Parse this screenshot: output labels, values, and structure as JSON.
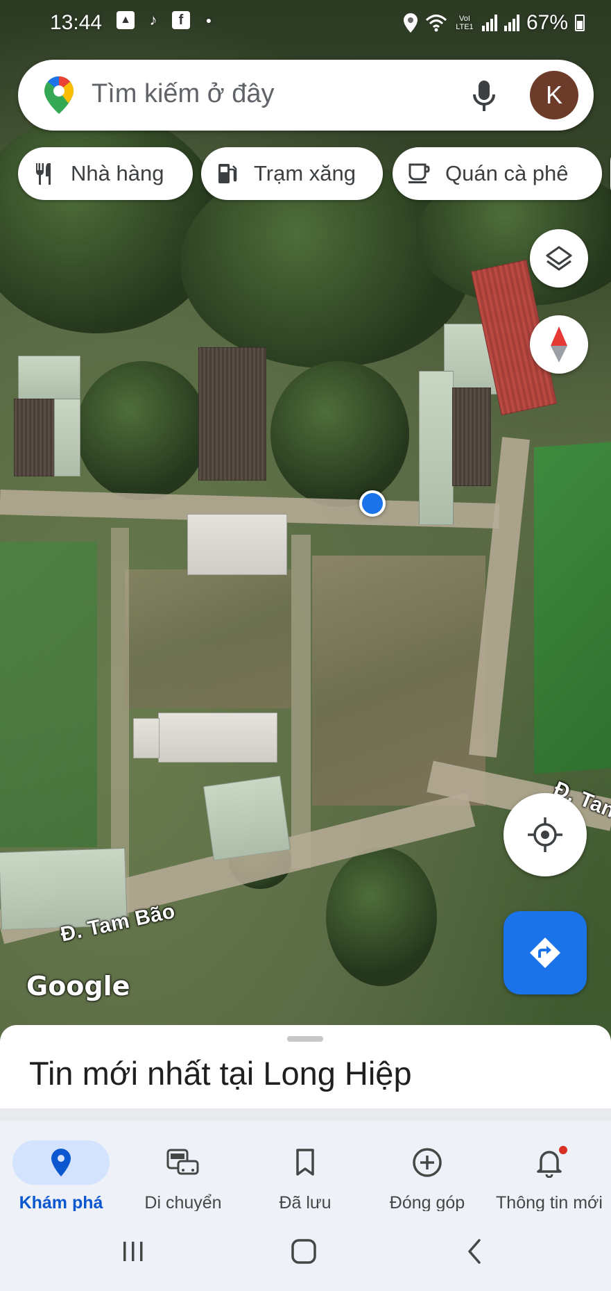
{
  "status_bar": {
    "time": "13:44",
    "left_icons": [
      "gallery-icon",
      "tiktok-icon",
      "facebook-icon",
      "dot-icon"
    ],
    "network_label": "VoI LTE1",
    "battery": "67%"
  },
  "search": {
    "placeholder": "Tìm kiếm ở đây",
    "avatar_letter": "K"
  },
  "chips": [
    {
      "label": "Nhà hàng",
      "icon": "restaurant-icon"
    },
    {
      "label": "Trạm xăng",
      "icon": "gas-station-icon"
    },
    {
      "label": "Quán cà phê",
      "icon": "coffee-icon"
    }
  ],
  "map": {
    "road_labels": [
      "Đ. Tam Bão",
      "Đ. Tan"
    ],
    "attribution": "Google"
  },
  "sheet": {
    "title": "Tin mới nhất tại Long Hiệp"
  },
  "nav": [
    {
      "label": "Khám phá",
      "icon": "explore-pin-icon",
      "active": true
    },
    {
      "label": "Di chuyển",
      "icon": "commute-icon",
      "active": false
    },
    {
      "label": "Đã lưu",
      "icon": "bookmark-icon",
      "active": false
    },
    {
      "label": "Đóng góp",
      "icon": "add-circle-icon",
      "active": false
    },
    {
      "label": "Thông tin mới",
      "icon": "bell-icon",
      "active": false
    }
  ],
  "colors": {
    "accent": "#1a73e8",
    "nav_active": "#0b57d0",
    "nav_pill": "#d3e3fd",
    "avatar_bg": "#6d3b2a"
  }
}
